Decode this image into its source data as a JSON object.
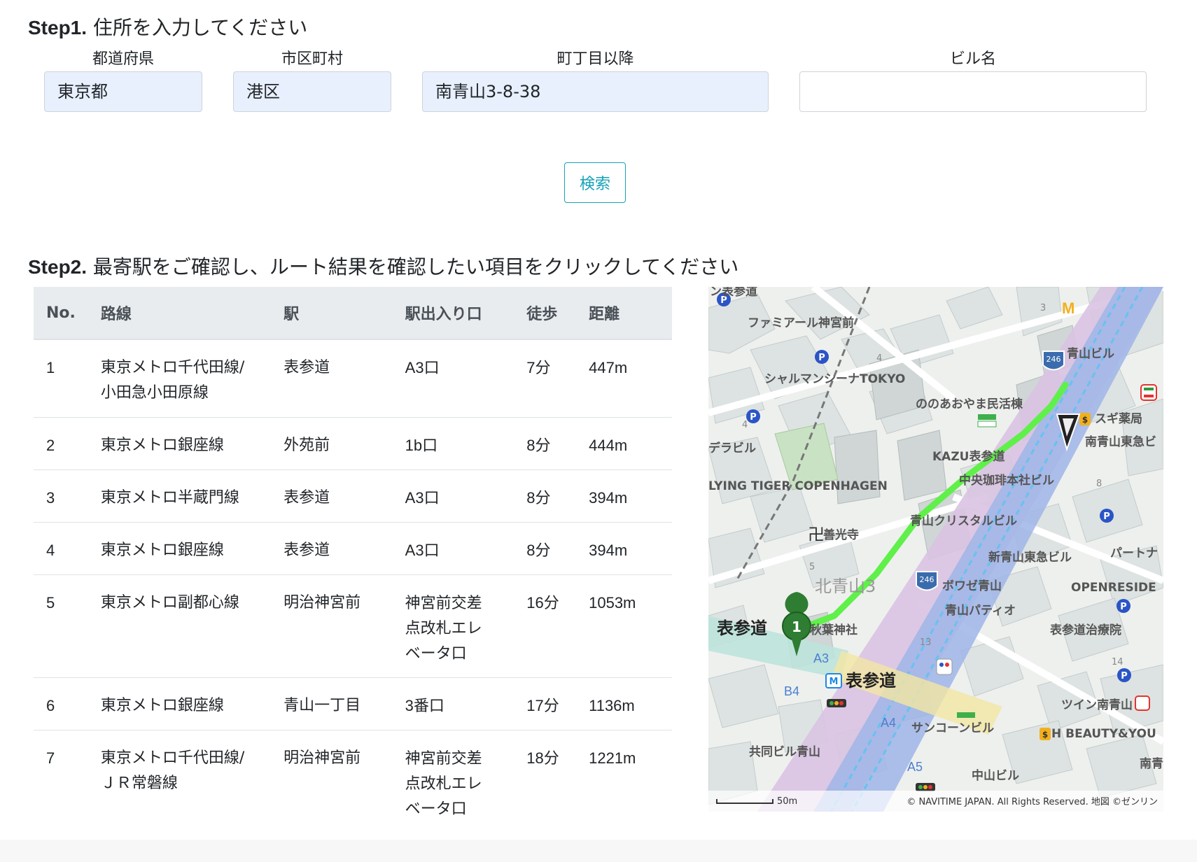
{
  "step1": {
    "prefix": "Step1.",
    "text": " 住所を入力してください"
  },
  "form": {
    "prefecture": {
      "label": "都道府県",
      "value": "東京都"
    },
    "city": {
      "label": "市区町村",
      "value": "港区"
    },
    "town": {
      "label": "町丁目以降",
      "value": "南青山3-8-38"
    },
    "building": {
      "label": "ビル名",
      "value": ""
    },
    "search_label": "検索"
  },
  "step2": {
    "prefix": "Step2.",
    "text": " 最寄駅をご確認し、ルート結果を確認したい項目をクリックしてください"
  },
  "table": {
    "headers": [
      "No.",
      "路線",
      "駅",
      "駅出入り口",
      "徒歩",
      "距離"
    ],
    "rows": [
      [
        "1",
        "東京メトロ千代田線/\n小田急小田原線",
        "表参道",
        "A3口",
        "7分",
        "447m"
      ],
      [
        "2",
        "東京メトロ銀座線",
        "外苑前",
        "1b口",
        "8分",
        "444m"
      ],
      [
        "3",
        "東京メトロ半蔵門線",
        "表参道",
        "A3口",
        "8分",
        "394m"
      ],
      [
        "4",
        "東京メトロ銀座線",
        "表参道",
        "A3口",
        "8分",
        "394m"
      ],
      [
        "5",
        "東京メトロ副都心線",
        "明治神宮前",
        "神宮前交差\n点改札エレ\nベータ口",
        "16分",
        "1053m"
      ],
      [
        "6",
        "東京メトロ銀座線",
        "青山一丁目",
        "3番口",
        "17分",
        "1136m"
      ],
      [
        "7",
        "東京メトロ千代田線/\nＪＲ常磐線",
        "明治神宮前",
        "神宮前交差\n点改札エレ\nベータ口",
        "18分",
        "1221m"
      ]
    ]
  },
  "map": {
    "labels": {
      "omotesando_top": "ン表参道",
      "familymart": "ファミアール神宮前",
      "charmant": "シャルマンシーナTOKYO",
      "nonoaoyama": "ののあおやま民活棟",
      "aoyama_bldg": "青山ビル",
      "sugi": "スギ薬局",
      "minami_tokyu": "南青山東急ビ",
      "dela": "デラビル",
      "kazu": "KAZU表参道",
      "chuo_coffee": "中央珈琲本社ビル",
      "flying_tiger": "LYING TIGER COPENHAGEN",
      "crystal": "青山クリスタルビル",
      "zenkoji": "善光寺",
      "shin_aoyama": "新青山東急ビル",
      "partner": "パートナ",
      "kita_aoyama": "北青山3",
      "bowaze": "ボワゼ青山",
      "openreside": "OPENRESIDE",
      "aoyama_patio": "青山パティオ",
      "akiba": "秋葉神社",
      "omotesando_w": "表参道",
      "omotesando_st": "表参道",
      "clinic": "表参道治療院",
      "twin": "ツイン南青山",
      "sanko": "サンコーンビル",
      "kyodo": "共同ビル青山",
      "hbeauty": "H BEAUTY&YOU",
      "nakayama": "中山ビル",
      "minami_r": "南青",
      "exit_a3": "A3",
      "exit_b4": "B4",
      "exit_a4": "A4",
      "exit_a5": "A5",
      "route_246_a": "246",
      "route_246_b": "246",
      "scale": "50m",
      "copyright": "© NAVITIME JAPAN. All Rights Reserved. 地図 ©ゼンリン",
      "marker_start": "1",
      "n3": "3",
      "n4a": "4",
      "n4b": "4",
      "n5": "5",
      "n8": "8",
      "n13": "13",
      "n14": "14"
    }
  }
}
